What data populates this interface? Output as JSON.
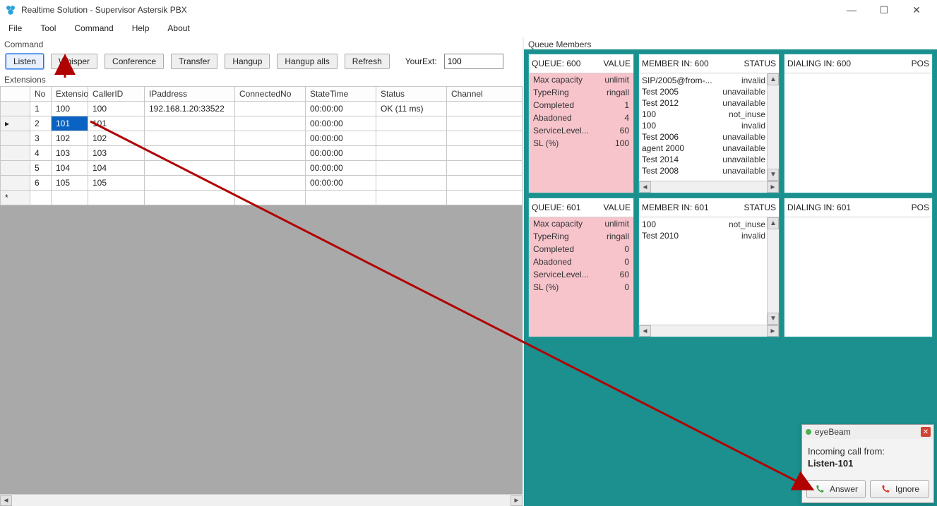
{
  "title": "Realtime Solution - Supervisor Astersik PBX",
  "menubar": [
    "File",
    "Tool",
    "Command",
    "Help",
    "About"
  ],
  "left": {
    "command_label": "Command",
    "buttons": [
      "Listen",
      "Whisper",
      "Conference",
      "Transfer",
      "Hangup",
      "Hangup alls",
      "Refresh"
    ],
    "yourext_label": "YourExt:",
    "yourext_value": "100",
    "extensions_label": "Extensions",
    "columns": [
      "No",
      "Extension",
      "CallerID",
      "IPaddress",
      "ConnectedNo",
      "StateTime",
      "Status",
      "Channel"
    ],
    "rows": [
      {
        "no": "1",
        "ext": "100",
        "cid": "100",
        "ip": "192.168.1.20:33522",
        "conn": "",
        "time": "00:00:00",
        "status": "OK (11 ms)",
        "ch": ""
      },
      {
        "no": "2",
        "ext": "101",
        "cid": "101",
        "ip": "",
        "conn": "",
        "time": "00:00:00",
        "status": "",
        "ch": ""
      },
      {
        "no": "3",
        "ext": "102",
        "cid": "102",
        "ip": "",
        "conn": "",
        "time": "00:00:00",
        "status": "",
        "ch": ""
      },
      {
        "no": "4",
        "ext": "103",
        "cid": "103",
        "ip": "",
        "conn": "",
        "time": "00:00:00",
        "status": "",
        "ch": ""
      },
      {
        "no": "5",
        "ext": "104",
        "cid": "104",
        "ip": "",
        "conn": "",
        "time": "00:00:00",
        "status": "",
        "ch": ""
      },
      {
        "no": "6",
        "ext": "105",
        "cid": "105",
        "ip": "",
        "conn": "",
        "time": "00:00:00",
        "status": "",
        "ch": ""
      }
    ],
    "selected_row_index": 1
  },
  "right": {
    "section_label": "Queue Members",
    "queues": [
      {
        "queue_heading": "QUEUE: 600",
        "value_heading": "VALUE",
        "member_heading": "MEMBER IN: 600",
        "status_heading": "STATUS",
        "dial_heading": "DIALING IN: 600",
        "pos_heading": "POS",
        "stats": [
          {
            "k": "Max capacity",
            "v": "unlimit"
          },
          {
            "k": "TypeRing",
            "v": "ringall"
          },
          {
            "k": "Completed",
            "v": "1"
          },
          {
            "k": "Abadoned",
            "v": "4"
          },
          {
            "k": "ServiceLevel...",
            "v": "60"
          },
          {
            "k": "SL (%)",
            "v": "100"
          }
        ],
        "members": [
          {
            "m": "SIP/2005@from-...",
            "s": "invalid"
          },
          {
            "m": "Test 2005",
            "s": "unavailable"
          },
          {
            "m": "Test 2012",
            "s": "unavailable"
          },
          {
            "m": "100",
            "s": "not_inuse"
          },
          {
            "m": "100",
            "s": "invalid"
          },
          {
            "m": "Test 2006",
            "s": "unavailable"
          },
          {
            "m": "agent 2000",
            "s": "unavailable"
          },
          {
            "m": "Test 2014",
            "s": "unavailable"
          },
          {
            "m": "Test 2008",
            "s": "unavailable"
          }
        ]
      },
      {
        "queue_heading": "QUEUE: 601",
        "value_heading": "VALUE",
        "member_heading": "MEMBER IN: 601",
        "status_heading": "STATUS",
        "dial_heading": "DIALING IN: 601",
        "pos_heading": "POS",
        "stats": [
          {
            "k": "Max capacity",
            "v": "unlimit"
          },
          {
            "k": "TypeRing",
            "v": "ringall"
          },
          {
            "k": "Completed",
            "v": "0"
          },
          {
            "k": "Abadoned",
            "v": "0"
          },
          {
            "k": "ServiceLevel...",
            "v": "60"
          },
          {
            "k": "SL (%)",
            "v": "0"
          }
        ],
        "members": [
          {
            "m": "100",
            "s": "not_inuse"
          },
          {
            "m": "Test 2010",
            "s": "invalid"
          }
        ]
      }
    ]
  },
  "popup": {
    "title": "eyeBeam",
    "from_label": "Incoming call from:",
    "from_value": "Listen-101",
    "answer": "Answer",
    "ignore": "Ignore"
  }
}
